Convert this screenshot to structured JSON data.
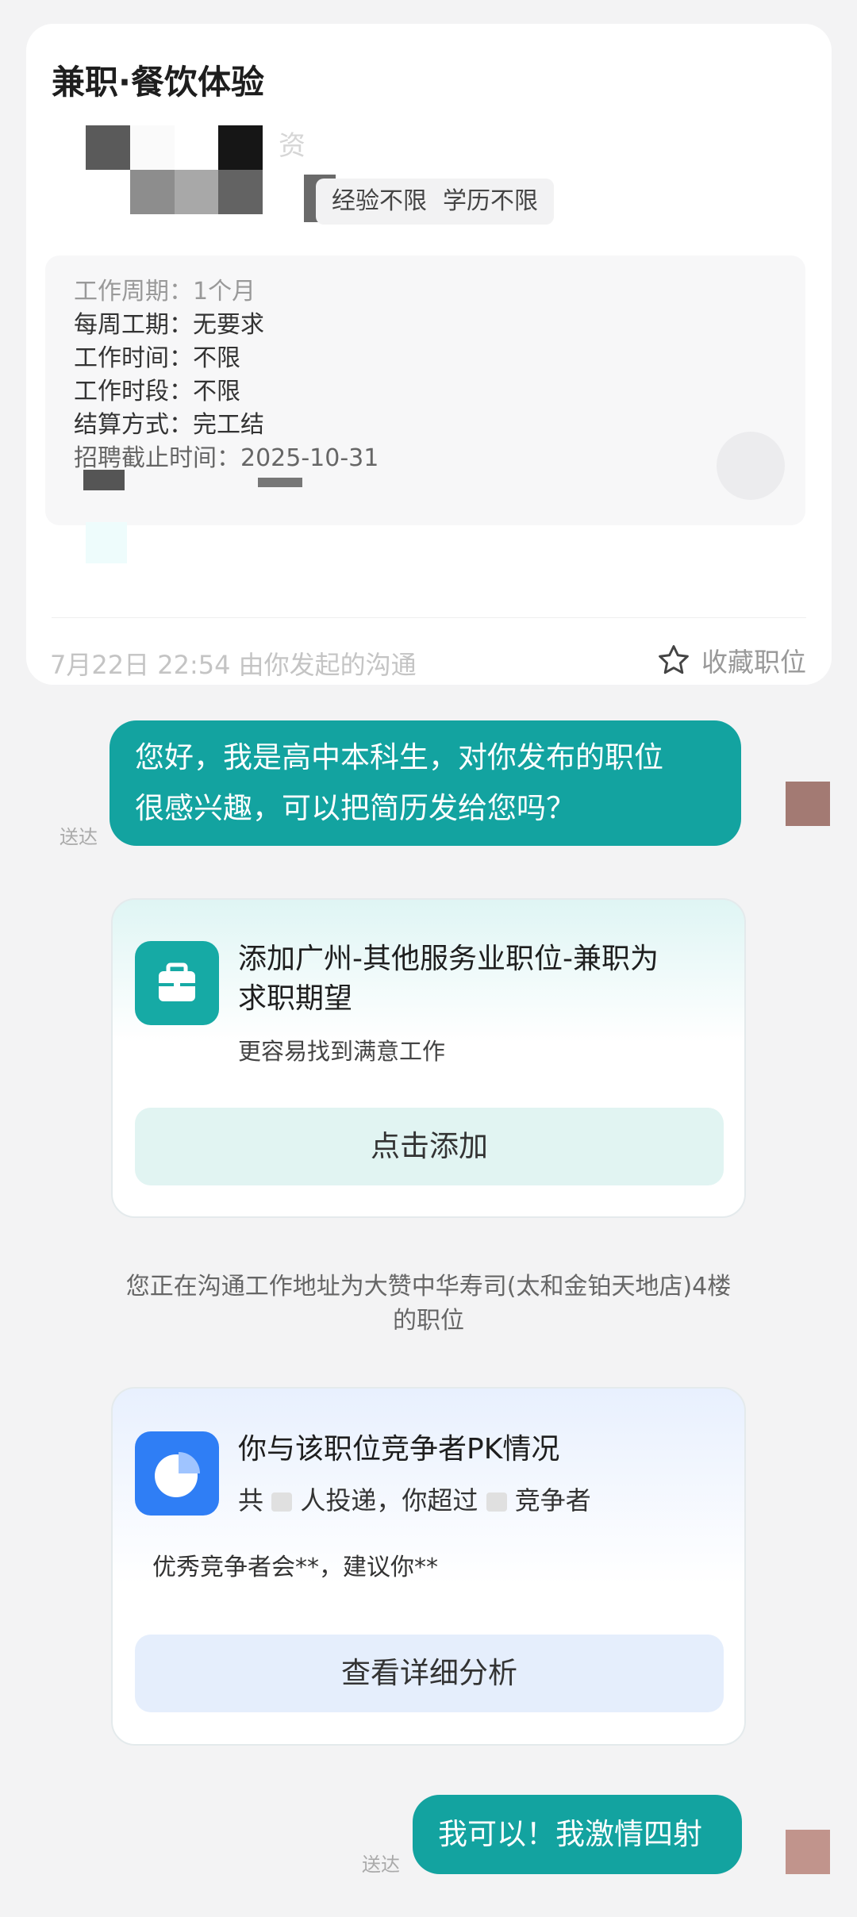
{
  "job": {
    "title": "兼职·餐饮体验",
    "salary_partial": "资",
    "tags": [
      "经验不限",
      "学历不限"
    ],
    "details": [
      "工作周期：1个月",
      "每周工期：无要求",
      "工作时间：不限",
      "工作时段：不限",
      "结算方式：完工结",
      "招聘截止时间：2025-10-31"
    ],
    "footer_time": "7月22日 22:54 由你发起的沟通",
    "favorite_label": "收藏职位"
  },
  "messages": {
    "first": {
      "line1": "您好，我是高中本科生，对你发布的职位",
      "line2": "很感兴趣，可以把简历发给您吗？",
      "status": "送达"
    },
    "second": {
      "text": "我可以！我激情四射",
      "status": "送达"
    }
  },
  "expectation_card": {
    "title_line1": "添加广州-其他服务业职位-兼职为",
    "title_line2": "求职期望",
    "subtitle": "更容易找到满意工作",
    "button": "点击添加",
    "icon": "briefcase-icon"
  },
  "address_notice": {
    "line1": "您正在沟通工作地址为大赞中华寿司(太和金铂天地店)4楼",
    "line2": "的职位"
  },
  "pk_card": {
    "title": "你与该职位竞争者PK情况",
    "stat_prefix": "共",
    "stat_mid": "人投递，你超过",
    "stat_suffix": "竞争者",
    "advice": "优秀竞争者会**，建议你**",
    "button": "查看详细分析",
    "icon": "pie-chart-icon"
  },
  "colors": {
    "accent": "#13a3a0",
    "page_bg": "#f3f3f4"
  }
}
